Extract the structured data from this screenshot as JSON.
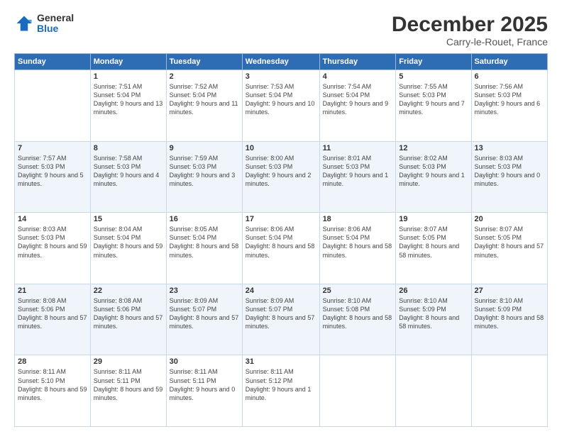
{
  "header": {
    "logo_general": "General",
    "logo_blue": "Blue",
    "title": "December 2025",
    "subtitle": "Carry-le-Rouet, France"
  },
  "days_of_week": [
    "Sunday",
    "Monday",
    "Tuesday",
    "Wednesday",
    "Thursday",
    "Friday",
    "Saturday"
  ],
  "weeks": [
    [
      {
        "day": "",
        "sunrise": "",
        "sunset": "",
        "daylight": ""
      },
      {
        "day": "1",
        "sunrise": "Sunrise: 7:51 AM",
        "sunset": "Sunset: 5:04 PM",
        "daylight": "Daylight: 9 hours and 13 minutes."
      },
      {
        "day": "2",
        "sunrise": "Sunrise: 7:52 AM",
        "sunset": "Sunset: 5:04 PM",
        "daylight": "Daylight: 9 hours and 11 minutes."
      },
      {
        "day": "3",
        "sunrise": "Sunrise: 7:53 AM",
        "sunset": "Sunset: 5:04 PM",
        "daylight": "Daylight: 9 hours and 10 minutes."
      },
      {
        "day": "4",
        "sunrise": "Sunrise: 7:54 AM",
        "sunset": "Sunset: 5:04 PM",
        "daylight": "Daylight: 9 hours and 9 minutes."
      },
      {
        "day": "5",
        "sunrise": "Sunrise: 7:55 AM",
        "sunset": "Sunset: 5:03 PM",
        "daylight": "Daylight: 9 hours and 7 minutes."
      },
      {
        "day": "6",
        "sunrise": "Sunrise: 7:56 AM",
        "sunset": "Sunset: 5:03 PM",
        "daylight": "Daylight: 9 hours and 6 minutes."
      }
    ],
    [
      {
        "day": "7",
        "sunrise": "Sunrise: 7:57 AM",
        "sunset": "Sunset: 5:03 PM",
        "daylight": "Daylight: 9 hours and 5 minutes."
      },
      {
        "day": "8",
        "sunrise": "Sunrise: 7:58 AM",
        "sunset": "Sunset: 5:03 PM",
        "daylight": "Daylight: 9 hours and 4 minutes."
      },
      {
        "day": "9",
        "sunrise": "Sunrise: 7:59 AM",
        "sunset": "Sunset: 5:03 PM",
        "daylight": "Daylight: 9 hours and 3 minutes."
      },
      {
        "day": "10",
        "sunrise": "Sunrise: 8:00 AM",
        "sunset": "Sunset: 5:03 PM",
        "daylight": "Daylight: 9 hours and 2 minutes."
      },
      {
        "day": "11",
        "sunrise": "Sunrise: 8:01 AM",
        "sunset": "Sunset: 5:03 PM",
        "daylight": "Daylight: 9 hours and 1 minute."
      },
      {
        "day": "12",
        "sunrise": "Sunrise: 8:02 AM",
        "sunset": "Sunset: 5:03 PM",
        "daylight": "Daylight: 9 hours and 1 minute."
      },
      {
        "day": "13",
        "sunrise": "Sunrise: 8:03 AM",
        "sunset": "Sunset: 5:03 PM",
        "daylight": "Daylight: 9 hours and 0 minutes."
      }
    ],
    [
      {
        "day": "14",
        "sunrise": "Sunrise: 8:03 AM",
        "sunset": "Sunset: 5:03 PM",
        "daylight": "Daylight: 8 hours and 59 minutes."
      },
      {
        "day": "15",
        "sunrise": "Sunrise: 8:04 AM",
        "sunset": "Sunset: 5:04 PM",
        "daylight": "Daylight: 8 hours and 59 minutes."
      },
      {
        "day": "16",
        "sunrise": "Sunrise: 8:05 AM",
        "sunset": "Sunset: 5:04 PM",
        "daylight": "Daylight: 8 hours and 58 minutes."
      },
      {
        "day": "17",
        "sunrise": "Sunrise: 8:06 AM",
        "sunset": "Sunset: 5:04 PM",
        "daylight": "Daylight: 8 hours and 58 minutes."
      },
      {
        "day": "18",
        "sunrise": "Sunrise: 8:06 AM",
        "sunset": "Sunset: 5:04 PM",
        "daylight": "Daylight: 8 hours and 58 minutes."
      },
      {
        "day": "19",
        "sunrise": "Sunrise: 8:07 AM",
        "sunset": "Sunset: 5:05 PM",
        "daylight": "Daylight: 8 hours and 58 minutes."
      },
      {
        "day": "20",
        "sunrise": "Sunrise: 8:07 AM",
        "sunset": "Sunset: 5:05 PM",
        "daylight": "Daylight: 8 hours and 57 minutes."
      }
    ],
    [
      {
        "day": "21",
        "sunrise": "Sunrise: 8:08 AM",
        "sunset": "Sunset: 5:06 PM",
        "daylight": "Daylight: 8 hours and 57 minutes."
      },
      {
        "day": "22",
        "sunrise": "Sunrise: 8:08 AM",
        "sunset": "Sunset: 5:06 PM",
        "daylight": "Daylight: 8 hours and 57 minutes."
      },
      {
        "day": "23",
        "sunrise": "Sunrise: 8:09 AM",
        "sunset": "Sunset: 5:07 PM",
        "daylight": "Daylight: 8 hours and 57 minutes."
      },
      {
        "day": "24",
        "sunrise": "Sunrise: 8:09 AM",
        "sunset": "Sunset: 5:07 PM",
        "daylight": "Daylight: 8 hours and 57 minutes."
      },
      {
        "day": "25",
        "sunrise": "Sunrise: 8:10 AM",
        "sunset": "Sunset: 5:08 PM",
        "daylight": "Daylight: 8 hours and 58 minutes."
      },
      {
        "day": "26",
        "sunrise": "Sunrise: 8:10 AM",
        "sunset": "Sunset: 5:09 PM",
        "daylight": "Daylight: 8 hours and 58 minutes."
      },
      {
        "day": "27",
        "sunrise": "Sunrise: 8:10 AM",
        "sunset": "Sunset: 5:09 PM",
        "daylight": "Daylight: 8 hours and 58 minutes."
      }
    ],
    [
      {
        "day": "28",
        "sunrise": "Sunrise: 8:11 AM",
        "sunset": "Sunset: 5:10 PM",
        "daylight": "Daylight: 8 hours and 59 minutes."
      },
      {
        "day": "29",
        "sunrise": "Sunrise: 8:11 AM",
        "sunset": "Sunset: 5:11 PM",
        "daylight": "Daylight: 8 hours and 59 minutes."
      },
      {
        "day": "30",
        "sunrise": "Sunrise: 8:11 AM",
        "sunset": "Sunset: 5:11 PM",
        "daylight": "Daylight: 9 hours and 0 minutes."
      },
      {
        "day": "31",
        "sunrise": "Sunrise: 8:11 AM",
        "sunset": "Sunset: 5:12 PM",
        "daylight": "Daylight: 9 hours and 1 minute."
      },
      {
        "day": "",
        "sunrise": "",
        "sunset": "",
        "daylight": ""
      },
      {
        "day": "",
        "sunrise": "",
        "sunset": "",
        "daylight": ""
      },
      {
        "day": "",
        "sunrise": "",
        "sunset": "",
        "daylight": ""
      }
    ]
  ]
}
